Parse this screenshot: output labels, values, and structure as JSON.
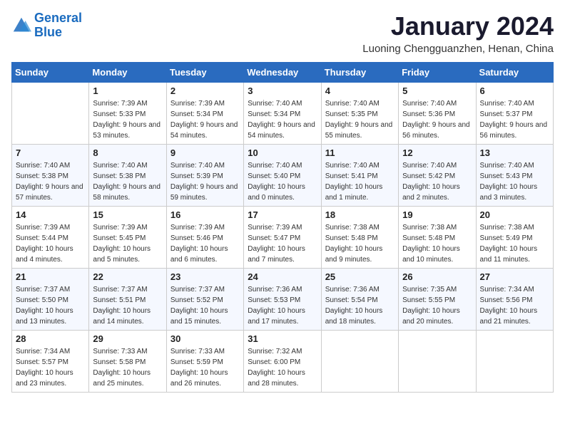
{
  "logo": {
    "line1": "General",
    "line2": "Blue"
  },
  "title": "January 2024",
  "subtitle": "Luoning Chengguanzhen, Henan, China",
  "weekdays": [
    "Sunday",
    "Monday",
    "Tuesday",
    "Wednesday",
    "Thursday",
    "Friday",
    "Saturday"
  ],
  "weeks": [
    [
      {
        "day": "",
        "sunrise": "",
        "sunset": "",
        "daylight": ""
      },
      {
        "day": "1",
        "sunrise": "Sunrise: 7:39 AM",
        "sunset": "Sunset: 5:33 PM",
        "daylight": "Daylight: 9 hours and 53 minutes."
      },
      {
        "day": "2",
        "sunrise": "Sunrise: 7:39 AM",
        "sunset": "Sunset: 5:34 PM",
        "daylight": "Daylight: 9 hours and 54 minutes."
      },
      {
        "day": "3",
        "sunrise": "Sunrise: 7:40 AM",
        "sunset": "Sunset: 5:34 PM",
        "daylight": "Daylight: 9 hours and 54 minutes."
      },
      {
        "day": "4",
        "sunrise": "Sunrise: 7:40 AM",
        "sunset": "Sunset: 5:35 PM",
        "daylight": "Daylight: 9 hours and 55 minutes."
      },
      {
        "day": "5",
        "sunrise": "Sunrise: 7:40 AM",
        "sunset": "Sunset: 5:36 PM",
        "daylight": "Daylight: 9 hours and 56 minutes."
      },
      {
        "day": "6",
        "sunrise": "Sunrise: 7:40 AM",
        "sunset": "Sunset: 5:37 PM",
        "daylight": "Daylight: 9 hours and 56 minutes."
      }
    ],
    [
      {
        "day": "7",
        "sunrise": "Sunrise: 7:40 AM",
        "sunset": "Sunset: 5:38 PM",
        "daylight": "Daylight: 9 hours and 57 minutes."
      },
      {
        "day": "8",
        "sunrise": "Sunrise: 7:40 AM",
        "sunset": "Sunset: 5:38 PM",
        "daylight": "Daylight: 9 hours and 58 minutes."
      },
      {
        "day": "9",
        "sunrise": "Sunrise: 7:40 AM",
        "sunset": "Sunset: 5:39 PM",
        "daylight": "Daylight: 9 hours and 59 minutes."
      },
      {
        "day": "10",
        "sunrise": "Sunrise: 7:40 AM",
        "sunset": "Sunset: 5:40 PM",
        "daylight": "Daylight: 10 hours and 0 minutes."
      },
      {
        "day": "11",
        "sunrise": "Sunrise: 7:40 AM",
        "sunset": "Sunset: 5:41 PM",
        "daylight": "Daylight: 10 hours and 1 minute."
      },
      {
        "day": "12",
        "sunrise": "Sunrise: 7:40 AM",
        "sunset": "Sunset: 5:42 PM",
        "daylight": "Daylight: 10 hours and 2 minutes."
      },
      {
        "day": "13",
        "sunrise": "Sunrise: 7:40 AM",
        "sunset": "Sunset: 5:43 PM",
        "daylight": "Daylight: 10 hours and 3 minutes."
      }
    ],
    [
      {
        "day": "14",
        "sunrise": "Sunrise: 7:39 AM",
        "sunset": "Sunset: 5:44 PM",
        "daylight": "Daylight: 10 hours and 4 minutes."
      },
      {
        "day": "15",
        "sunrise": "Sunrise: 7:39 AM",
        "sunset": "Sunset: 5:45 PM",
        "daylight": "Daylight: 10 hours and 5 minutes."
      },
      {
        "day": "16",
        "sunrise": "Sunrise: 7:39 AM",
        "sunset": "Sunset: 5:46 PM",
        "daylight": "Daylight: 10 hours and 6 minutes."
      },
      {
        "day": "17",
        "sunrise": "Sunrise: 7:39 AM",
        "sunset": "Sunset: 5:47 PM",
        "daylight": "Daylight: 10 hours and 7 minutes."
      },
      {
        "day": "18",
        "sunrise": "Sunrise: 7:38 AM",
        "sunset": "Sunset: 5:48 PM",
        "daylight": "Daylight: 10 hours and 9 minutes."
      },
      {
        "day": "19",
        "sunrise": "Sunrise: 7:38 AM",
        "sunset": "Sunset: 5:48 PM",
        "daylight": "Daylight: 10 hours and 10 minutes."
      },
      {
        "day": "20",
        "sunrise": "Sunrise: 7:38 AM",
        "sunset": "Sunset: 5:49 PM",
        "daylight": "Daylight: 10 hours and 11 minutes."
      }
    ],
    [
      {
        "day": "21",
        "sunrise": "Sunrise: 7:37 AM",
        "sunset": "Sunset: 5:50 PM",
        "daylight": "Daylight: 10 hours and 13 minutes."
      },
      {
        "day": "22",
        "sunrise": "Sunrise: 7:37 AM",
        "sunset": "Sunset: 5:51 PM",
        "daylight": "Daylight: 10 hours and 14 minutes."
      },
      {
        "day": "23",
        "sunrise": "Sunrise: 7:37 AM",
        "sunset": "Sunset: 5:52 PM",
        "daylight": "Daylight: 10 hours and 15 minutes."
      },
      {
        "day": "24",
        "sunrise": "Sunrise: 7:36 AM",
        "sunset": "Sunset: 5:53 PM",
        "daylight": "Daylight: 10 hours and 17 minutes."
      },
      {
        "day": "25",
        "sunrise": "Sunrise: 7:36 AM",
        "sunset": "Sunset: 5:54 PM",
        "daylight": "Daylight: 10 hours and 18 minutes."
      },
      {
        "day": "26",
        "sunrise": "Sunrise: 7:35 AM",
        "sunset": "Sunset: 5:55 PM",
        "daylight": "Daylight: 10 hours and 20 minutes."
      },
      {
        "day": "27",
        "sunrise": "Sunrise: 7:34 AM",
        "sunset": "Sunset: 5:56 PM",
        "daylight": "Daylight: 10 hours and 21 minutes."
      }
    ],
    [
      {
        "day": "28",
        "sunrise": "Sunrise: 7:34 AM",
        "sunset": "Sunset: 5:57 PM",
        "daylight": "Daylight: 10 hours and 23 minutes."
      },
      {
        "day": "29",
        "sunrise": "Sunrise: 7:33 AM",
        "sunset": "Sunset: 5:58 PM",
        "daylight": "Daylight: 10 hours and 25 minutes."
      },
      {
        "day": "30",
        "sunrise": "Sunrise: 7:33 AM",
        "sunset": "Sunset: 5:59 PM",
        "daylight": "Daylight: 10 hours and 26 minutes."
      },
      {
        "day": "31",
        "sunrise": "Sunrise: 7:32 AM",
        "sunset": "Sunset: 6:00 PM",
        "daylight": "Daylight: 10 hours and 28 minutes."
      },
      {
        "day": "",
        "sunrise": "",
        "sunset": "",
        "daylight": ""
      },
      {
        "day": "",
        "sunrise": "",
        "sunset": "",
        "daylight": ""
      },
      {
        "day": "",
        "sunrise": "",
        "sunset": "",
        "daylight": ""
      }
    ]
  ]
}
